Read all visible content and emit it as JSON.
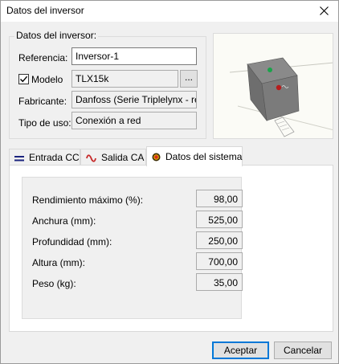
{
  "window": {
    "title": "Datos del inversor",
    "close_glyph": "X"
  },
  "inverter_group": {
    "legend": "Datos del inversor:",
    "referencia_label": "Referencia:",
    "referencia_value": "Inversor-1",
    "modelo_label": "Modelo",
    "modelo_checked": true,
    "modelo_value": "TLX15k",
    "browse_label": "...",
    "fabricante_label": "Fabricante:",
    "fabricante_value": "Danfoss (Serie Triplelynx - red)",
    "tipo_uso_label": "Tipo de uso:",
    "tipo_uso_value": "Conexión a red"
  },
  "tabs": [
    {
      "label": "Entrada CC",
      "icon": "dc-icon",
      "active": false
    },
    {
      "label": "Salida CA",
      "icon": "ac-wave-icon",
      "active": false
    },
    {
      "label": "Datos del sistema",
      "icon": "system-record-icon",
      "active": true
    }
  ],
  "system_data": {
    "rows": [
      {
        "label": "Rendimiento máximo (%):",
        "value": "98,00"
      },
      {
        "label": "Anchura (mm):",
        "value": "525,00"
      },
      {
        "label": "Profundidad (mm):",
        "value": "250,00"
      },
      {
        "label": "Altura (mm):",
        "value": "700,00"
      },
      {
        "label": "Peso (kg):",
        "value": "35,00"
      }
    ]
  },
  "buttons": {
    "accept": "Aceptar",
    "cancel": "Cancelar"
  },
  "colors": {
    "accent": "#0078d7",
    "dc_icon": "#1a237e",
    "ac_icon": "#c62828",
    "system_icon_outer": "#3a2a00",
    "system_icon_inner": "#d62b1e"
  }
}
